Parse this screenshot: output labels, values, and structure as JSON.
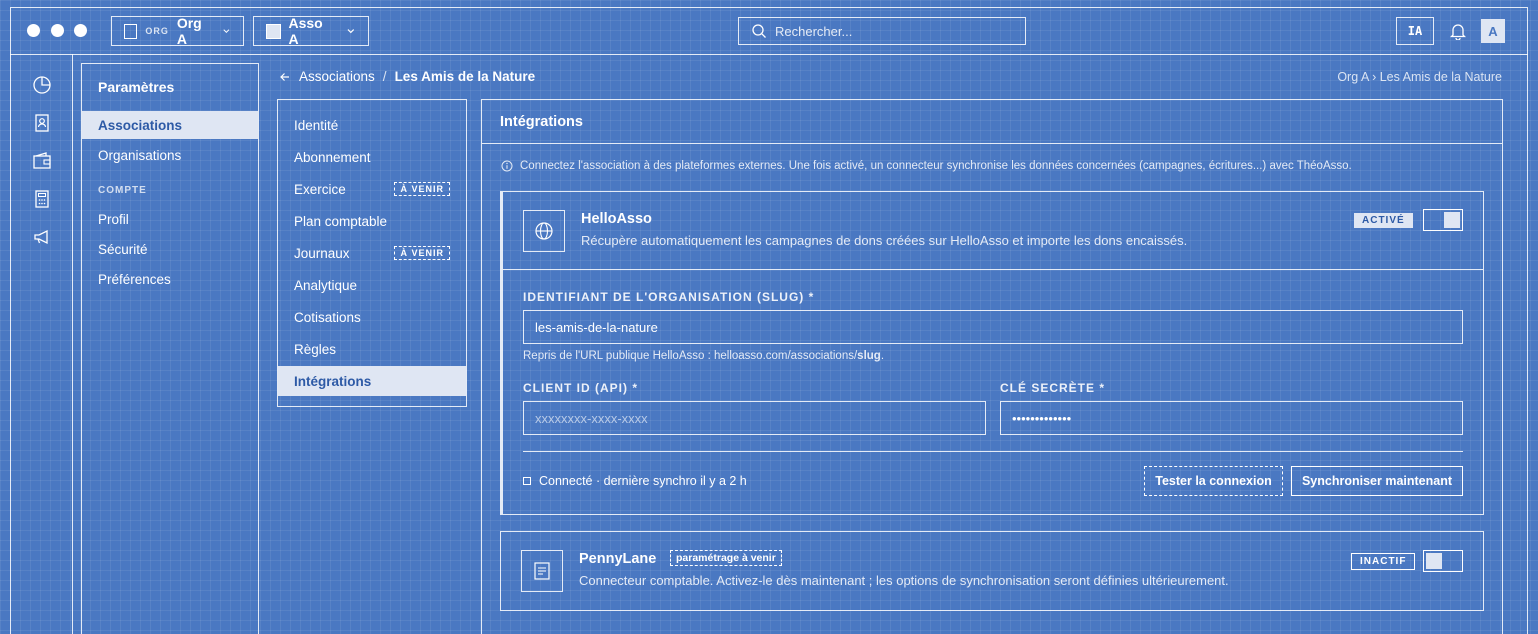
{
  "topbar": {
    "org_tag": "ORG",
    "org_name": "Org A",
    "asso_name": "Asso A",
    "search_placeholder": "Rechercher...",
    "ia_label": "IA",
    "avatar_letter": "A"
  },
  "rail": {
    "icons": [
      "chart-pie-icon",
      "contact-book-icon",
      "wallet-icon",
      "calculator-icon",
      "megaphone-icon"
    ]
  },
  "sidebar": {
    "title": "Paramètres",
    "items": [
      {
        "label": "Associations",
        "active": true
      },
      {
        "label": "Organisations",
        "active": false
      }
    ],
    "section_label": "COMPTE",
    "account_items": [
      {
        "label": "Profil"
      },
      {
        "label": "Sécurité"
      },
      {
        "label": "Préférences"
      }
    ]
  },
  "breadcrumb": {
    "parent": "Associations",
    "separator": "/",
    "current": "Les Amis de la Nature",
    "right_trail": "Org A › Les Amis de la Nature"
  },
  "subnav": {
    "items": [
      {
        "label": "Identité"
      },
      {
        "label": "Abonnement"
      },
      {
        "label": "Exercice",
        "badge": "À VENIR"
      },
      {
        "label": "Plan comptable"
      },
      {
        "label": "Journaux",
        "badge": "À VENIR"
      },
      {
        "label": "Analytique"
      },
      {
        "label": "Cotisations"
      },
      {
        "label": "Règles"
      },
      {
        "label": "Intégrations",
        "active": true
      }
    ]
  },
  "main": {
    "title": "Intégrations",
    "info": "Connectez l'association à des plateformes externes. Une fois activé, un connecteur synchronise les données concernées (campagnes, écritures...) avec ThéoAsso."
  },
  "helloasso": {
    "name": "HelloAsso",
    "description": "Récupère automatiquement les campagnes de dons créées sur HelloAsso et importe les dons encaissés.",
    "status": "ACTIVÉ",
    "enabled": true,
    "slug_label": "IDENTIFIANT DE L'ORGANISATION (SLUG) *",
    "slug_value": "les-amis-de-la-nature",
    "slug_hint_prefix": "Repris de l'URL publique HelloAsso : helloasso.com/associations/",
    "slug_hint_bold": "slug",
    "slug_hint_suffix": ".",
    "client_id_label": "CLIENT ID (API) *",
    "client_id_placeholder": "xxxxxxxx-xxxx-xxxx",
    "secret_label": "CLÉ SECRÈTE *",
    "secret_value": "•••••••••••••",
    "connection_status": "Connecté · dernière synchro il y a 2 h",
    "test_button": "Tester la connexion",
    "sync_button": "Synchroniser maintenant"
  },
  "pennylane": {
    "name": "PennyLane",
    "tag": "paramétrage à venir",
    "description": "Connecteur comptable. Activez-le dès maintenant ; les options de synchronisation seront définies ultérieurement.",
    "status": "INACTIF",
    "enabled": false
  }
}
